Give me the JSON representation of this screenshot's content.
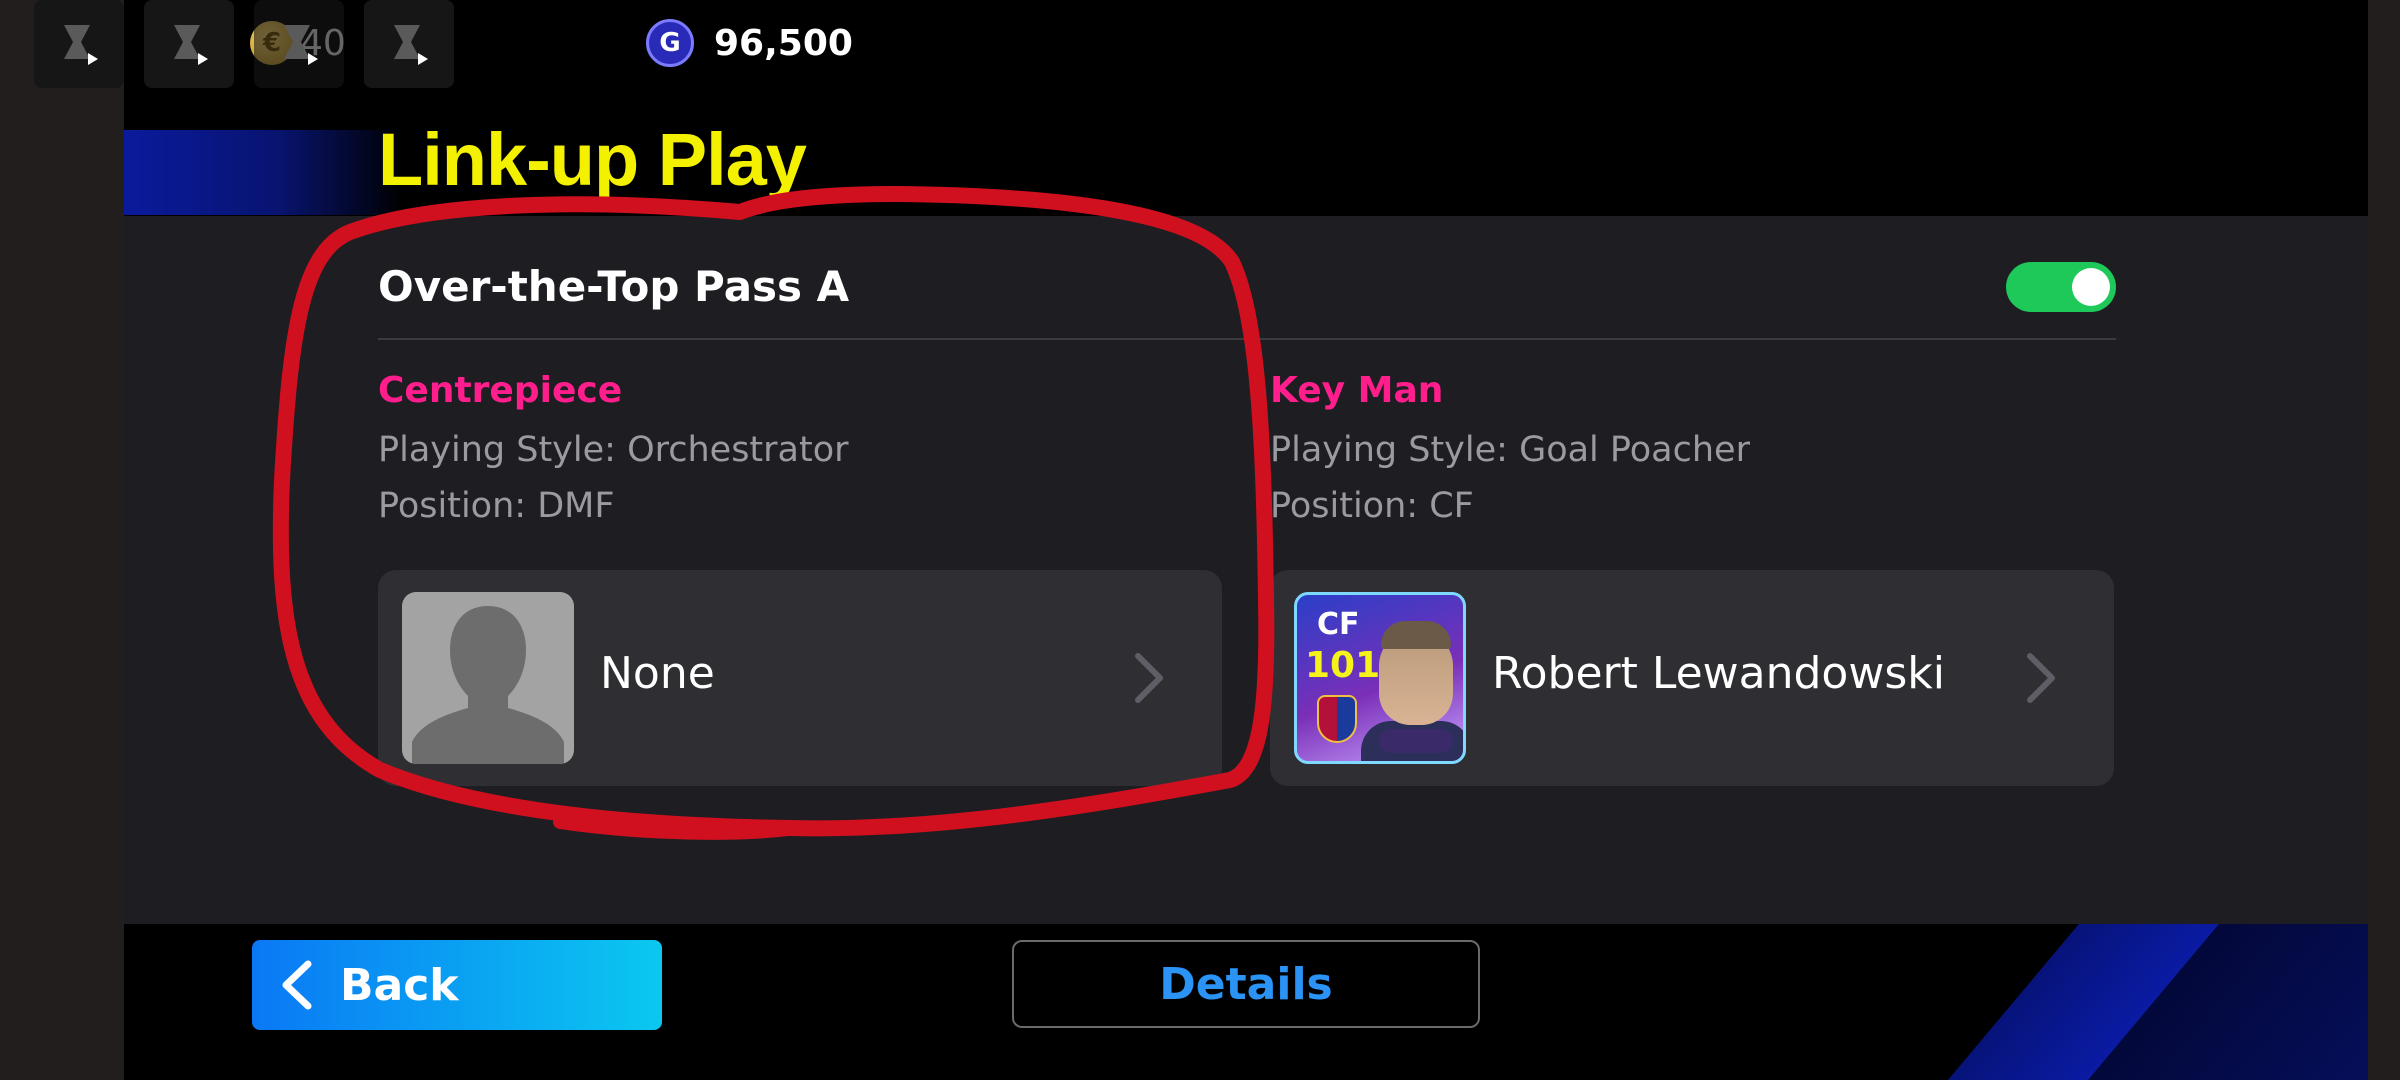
{
  "top_bar": {
    "ad_icons": [
      "hourglass-play-icon",
      "hourglass-play-icon",
      "hourglass-play-icon",
      "hourglass-play-icon"
    ],
    "coins_value": "40",
    "gp_value": "96,500",
    "gp_symbol": "G"
  },
  "page": {
    "title": "Link-up Play"
  },
  "card": {
    "title": "Over-the-Top Pass A",
    "toggle_on": true,
    "centrepiece": {
      "label": "Centrepiece",
      "playing_style": "Playing Style: Orchestrator",
      "position": "Position: DMF",
      "player_name": "None"
    },
    "key_man": {
      "label": "Key Man",
      "playing_style": "Playing Style: Goal Poacher",
      "position": "Position: CF",
      "player_name": "Robert Lewandowski",
      "card_position": "CF",
      "card_rating": "101"
    }
  },
  "buttons": {
    "back": "Back",
    "details": "Details"
  },
  "colors": {
    "title_yellow": "#f3f000",
    "role_pink": "#ff1e8c",
    "toggle_green": "#1ec95a",
    "details_blue": "#2a93f5",
    "annotation_red": "#d0101e"
  }
}
